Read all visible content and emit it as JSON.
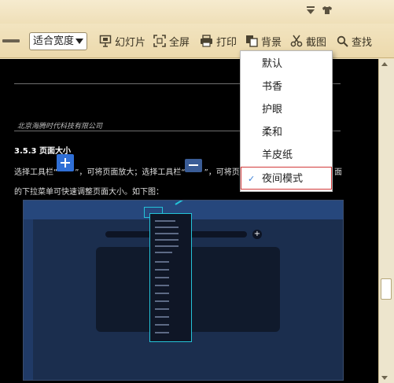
{
  "toolbar": {
    "zoom_value": "适合宽度",
    "slideshow": "幻灯片",
    "fullscreen": "全屏",
    "print": "打印",
    "background": "背景",
    "screenshot": "截图",
    "find": "查找"
  },
  "icons": {
    "zoom_out": "minus-icon",
    "dropdown_caret": "caret-down-icon",
    "slideshow": "slideshow-icon",
    "fullscreen": "fullscreen-icon",
    "print": "printer-icon",
    "background": "background-icon",
    "screenshot": "scissors-icon",
    "find": "search-icon",
    "title_menu": "menu-arrow-icon",
    "title_skin": "shirt-icon",
    "selected_mark": "check-icon"
  },
  "document": {
    "publisher": "北京海腾时代科技有限公司",
    "section_title": "3.5.3 页面大小",
    "line1_a": "选择工具栏“",
    "line1_b": "”，可将页面放大；选择工具栏“",
    "line1_c": "”，可将页面",
    "line1_d": "面",
    "line2": "的下拉菜单可快速调整页面大小。如下图："
  },
  "background_menu": {
    "items": [
      {
        "label": "默认",
        "selected": false
      },
      {
        "label": "书香",
        "selected": false
      },
      {
        "label": "护眼",
        "selected": false
      },
      {
        "label": "柔和",
        "selected": false
      },
      {
        "label": "羊皮纸",
        "selected": false
      },
      {
        "label": "夜间模式",
        "selected": true
      }
    ],
    "check": "✓"
  },
  "colors": {
    "toolbar_bg": "#efdfb8",
    "document_bg": "#000000",
    "accent_blue": "#2f6fd6",
    "selection_border": "#d23a3a",
    "highlight_cyan": "#24c3d8"
  }
}
